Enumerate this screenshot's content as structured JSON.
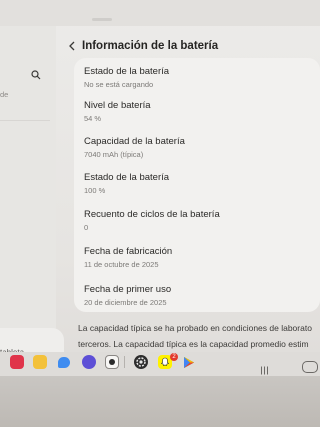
{
  "left_pane": {
    "top_snippet": "de",
    "bottom_snippet": "tableta"
  },
  "header": {
    "title": "Información de la batería"
  },
  "rows": [
    {
      "label": "Estado de la batería",
      "value": "No se está cargando"
    },
    {
      "label": "Nivel de batería",
      "value": "54 %"
    },
    {
      "label": "Capacidad de la batería",
      "value": "7040 mAh (típica)"
    },
    {
      "label": "Estado de la batería",
      "value": "100 %"
    },
    {
      "label": "Recuento de ciclos de la batería",
      "value": "0"
    },
    {
      "label": "Fecha de fabricación",
      "value": "11 de octubre de 2025"
    },
    {
      "label": "Fecha de primer uso",
      "value": "20 de diciembre de 2025"
    }
  ],
  "description": {
    "line1": "La capacidad típica se ha probado en condiciones de laborato",
    "line2": "terceros. La capacidad típica es la capacidad promedio estim"
  },
  "dock": {
    "apps": [
      "red-app-icon",
      "notes-icon",
      "messages-icon",
      "browser-icon",
      "camera-icon",
      "settings-icon",
      "snapchat-icon",
      "play-store-icon"
    ],
    "snapchat_badge": "2"
  },
  "colors": {
    "background": "#ecebe9",
    "card": "#f2f1ef",
    "title_text": "#262523",
    "secondary_text": "#7c7a77"
  }
}
